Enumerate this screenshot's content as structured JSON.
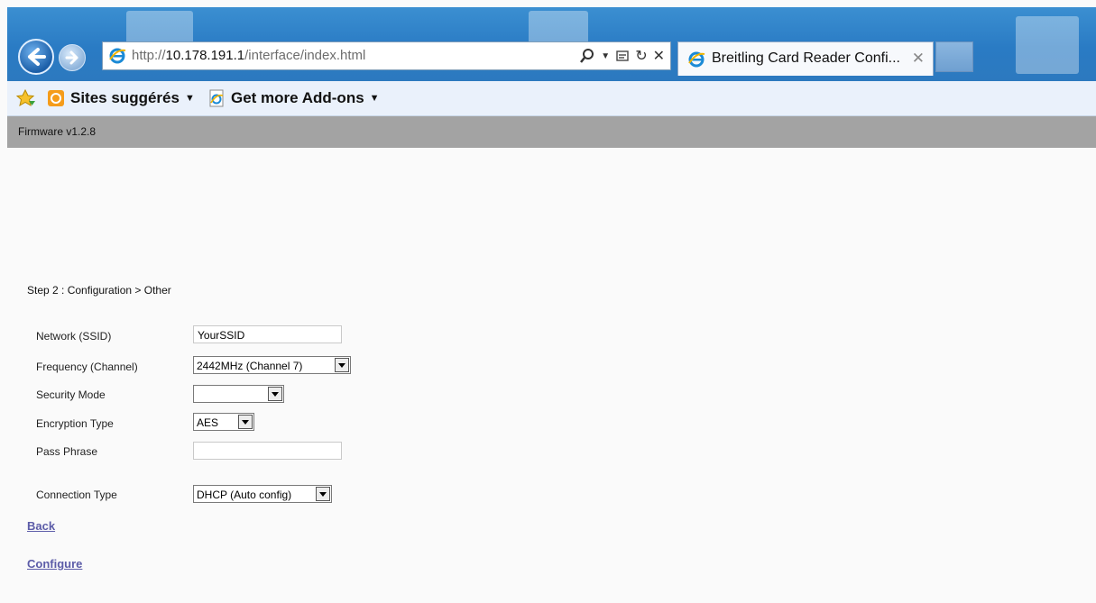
{
  "browser": {
    "url_prefix": "http://",
    "url_host": "10.178.191.1",
    "url_path": "/interface/index.html",
    "tab_title": "Breitling Card Reader Confi...",
    "tab_close": "✕",
    "toolbar_icons": [
      "search-icon",
      "dropdown-icon",
      "compat-view-icon",
      "refresh-icon",
      "stop-icon"
    ]
  },
  "favorites": {
    "items": [
      {
        "label": "Sites suggérés",
        "caret": "▼"
      },
      {
        "label": "Get more Add-ons",
        "caret": "▼"
      }
    ]
  },
  "header": {
    "firmware": "Firmware v1.2.8"
  },
  "main": {
    "step_title": "Step 2 : Configuration > Other",
    "network_label": "Network (SSID)",
    "network_value": "YourSSID",
    "frequency_label": "Frequency (Channel)",
    "frequency_value": "2442MHz (Channel 7)",
    "security_label": "Security Mode",
    "security_value": "",
    "encryption_label": "Encryption Type",
    "encryption_value": "AES",
    "passphrase_label": "Pass Phrase",
    "passphrase_value": "",
    "connection_label": "Connection Type",
    "connection_value": "DHCP (Auto config)",
    "back_link": "Back",
    "configure_link": "Configure"
  },
  "colors": {
    "chrome_blue": "#2a7bc4",
    "firmware_bar": "#a3a3a3",
    "link": "#5c5ca8"
  }
}
